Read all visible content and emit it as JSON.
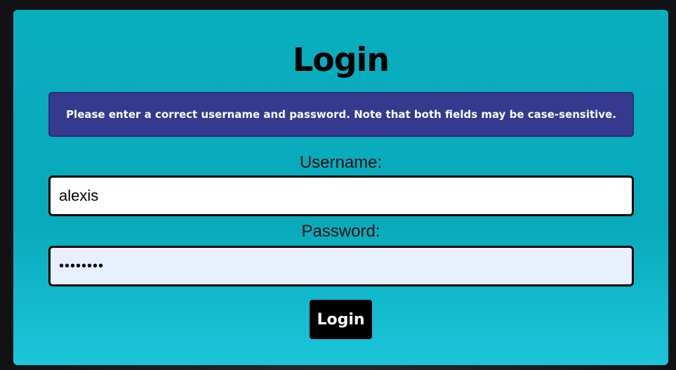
{
  "login": {
    "title": "Login",
    "error_message": "Please enter a correct username and password. Note that both fields may be case-sensitive.",
    "username_label": "Username:",
    "username_value": "alexis",
    "password_label": "Password:",
    "password_value": "abcdefgh",
    "submit_label": "Login"
  },
  "colors": {
    "card_background": "#09aebf",
    "error_background": "#353a8f",
    "button_background": "#000000",
    "password_autofill_background": "#e8f0fe"
  }
}
